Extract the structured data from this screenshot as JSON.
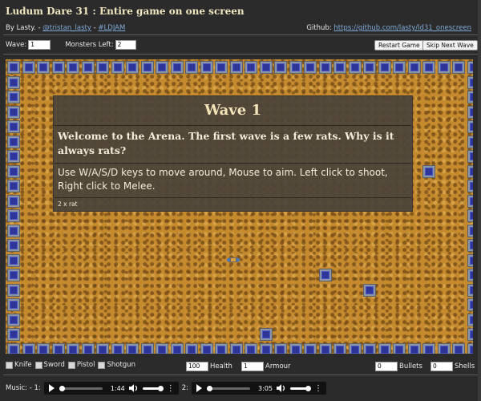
{
  "header": {
    "title": "Ludum Dare 31 : Entire game on one screen",
    "by_prefix": "By Lasty. - ",
    "twitter_link": "@tristan_lasty",
    "sep": " - ",
    "hashtag_link": "#LDJAM",
    "github_label": "Github: ",
    "github_link": "https://github.com/lasty/ld31_onescreen"
  },
  "controls": {
    "wave_label": "Wave:",
    "wave_value": "1",
    "monsters_label": "Monsters Left:",
    "monsters_value": "2",
    "restart_button": "Restart Game",
    "skip_button": "Skip Next Wave"
  },
  "dialog": {
    "title": "Wave 1",
    "intro": "Welcome to the Arena. The first wave is a few rats. Why is it always rats?",
    "instructions": "Use W/A/S/D keys to move around, Mouse to aim. Left click to shoot, Right click to Melee.",
    "enemies": "2 x rat"
  },
  "inventory": {
    "weapons": [
      "Knife",
      "Sword",
      "Pistol",
      "Shotgun"
    ],
    "health_value": "100",
    "health_label": "Health",
    "armour_value": "1",
    "armour_label": "Armour",
    "bullets_value": "0",
    "bullets_label": "Bullets",
    "shells_value": "0",
    "shells_label": "Shells"
  },
  "music": {
    "label": "Music: - 1:",
    "track1_time": "1:44",
    "track2_label": "2:",
    "track2_time": "3:05"
  },
  "colors": {
    "sand": "#c58a2e",
    "block_frame": "#8c96a2",
    "block_core": "#2d3598",
    "dialog_bg": "#4b443a"
  },
  "icons": [
    "play-icon",
    "volume-icon",
    "more-options-icon",
    "player-sprite"
  ]
}
